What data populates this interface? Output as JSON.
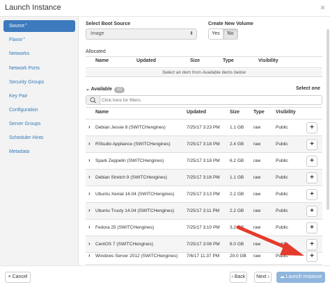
{
  "window": {
    "title": "Launch Instance",
    "close_glyph": "×"
  },
  "sidebar": {
    "items": [
      {
        "label": "Source",
        "required": "*",
        "active": true
      },
      {
        "label": "Flavor",
        "required": "*"
      },
      {
        "label": "Networks"
      },
      {
        "label": "Network Ports"
      },
      {
        "label": "Security Groups"
      },
      {
        "label": "Key Pair"
      },
      {
        "label": "Configuration"
      },
      {
        "label": "Server Groups"
      },
      {
        "label": "Scheduler Hints"
      },
      {
        "label": "Metadata"
      }
    ]
  },
  "boot_source": {
    "label": "Select Boot Source",
    "value": "Image"
  },
  "create_volume": {
    "label": "Create New Volume",
    "yes": "Yes",
    "no": "No",
    "selected": "No"
  },
  "allocated": {
    "label": "Allocated",
    "columns": [
      "Name",
      "Updated",
      "Size",
      "Type",
      "Visibility"
    ],
    "empty_message": "Select an item from Available items below"
  },
  "available": {
    "label": "Available",
    "count": "10",
    "select_hint": "Select one",
    "filter_placeholder": "Click here for filters.",
    "columns": [
      "Name",
      "Updated",
      "Size",
      "Type",
      "Visibility"
    ],
    "rows": [
      {
        "name": "Debian Jessie 8 (SWITCHengines)",
        "updated": "7/25/17 3:23 PM",
        "size": "1.1 GB",
        "type": "raw",
        "visibility": "Public"
      },
      {
        "name": "RStudio Appliance (SWITCHengines)",
        "updated": "7/25/17 3:18 PM",
        "size": "2.4 GB",
        "type": "raw",
        "visibility": "Public"
      },
      {
        "name": "Spark Zeppelin (SWITCHengines)",
        "updated": "7/25/17 3:18 PM",
        "size": "6.2 GB",
        "type": "raw",
        "visibility": "Public"
      },
      {
        "name": "Debian Stretch 9 (SWITCHengines)",
        "updated": "7/25/17 3:16 PM",
        "size": "1.1 GB",
        "type": "raw",
        "visibility": "Public"
      },
      {
        "name": "Ubuntu Xenial 16.04 (SWITCHengines)",
        "updated": "7/25/17 3:13 PM",
        "size": "2.2 GB",
        "type": "raw",
        "visibility": "Public"
      },
      {
        "name": "Ubuntu Trusty 14.04 (SWITCHengines)",
        "updated": "7/25/17 3:11 PM",
        "size": "2.2 GB",
        "type": "raw",
        "visibility": "Public"
      },
      {
        "name": "Fedora 25 (SWITCHengines)",
        "updated": "7/25/17 3:10 PM",
        "size": "3.2 GB",
        "type": "raw",
        "visibility": "Public"
      },
      {
        "name": "CentOS 7 (SWITCHengines)",
        "updated": "7/25/17 3:08 PM",
        "size": "8.0 GB",
        "type": "raw",
        "visibility": "Public"
      },
      {
        "name": "Windows Server 2012 (SWITCHengines)",
        "updated": "7/6/17 11:37 PM",
        "size": "20.0 GB",
        "type": "raw",
        "visibility": "Public"
      }
    ],
    "add_glyph": "+"
  },
  "footer": {
    "cancel": "Cancel",
    "back": "Back",
    "next": "Next",
    "launch": "Launch Instance"
  },
  "annotation": {
    "arrow_color": "#e53b2c"
  },
  "colors": {
    "accent": "#3c7abd",
    "link": "#337ab7",
    "launch_disabled": "#8fb6dd"
  }
}
